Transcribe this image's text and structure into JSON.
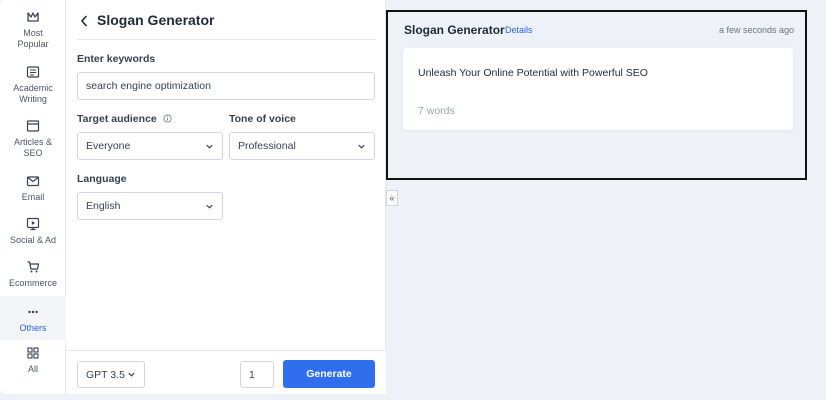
{
  "sidebar": {
    "items": [
      {
        "label": "Most Popular",
        "icon": "crown-icon"
      },
      {
        "label": "Academic Writing",
        "icon": "document-icon"
      },
      {
        "label": "Articles & SEO",
        "icon": "browser-icon"
      },
      {
        "label": "Email",
        "icon": "mail-icon"
      },
      {
        "label": "Social & Ad",
        "icon": "play-screen-icon"
      },
      {
        "label": "Ecommerce",
        "icon": "cart-icon"
      },
      {
        "label": "Others",
        "icon": "dots-icon"
      },
      {
        "label": "All",
        "icon": "grid-icon"
      }
    ]
  },
  "form": {
    "title": "Slogan Generator",
    "keywords_label": "Enter keywords",
    "keywords_value": "search engine optimization",
    "audience_label": "Target audience",
    "audience_value": "Everyone",
    "tone_label": "Tone of voice",
    "tone_value": "Professional",
    "language_label": "Language",
    "language_value": "English",
    "model_value": "GPT 3.5",
    "count_value": "1",
    "generate_label": "Generate"
  },
  "output": {
    "title": "Slogan Generator",
    "details_label": "Details",
    "timestamp": "a few seconds ago",
    "result_text": "Unleash Your Online Potential with Powerful SEO",
    "word_count": "7 words",
    "collapse_label": "«"
  },
  "colors": {
    "accent": "#2f6fee",
    "link": "#2563eb",
    "panel_bg": "#eef2f8"
  }
}
